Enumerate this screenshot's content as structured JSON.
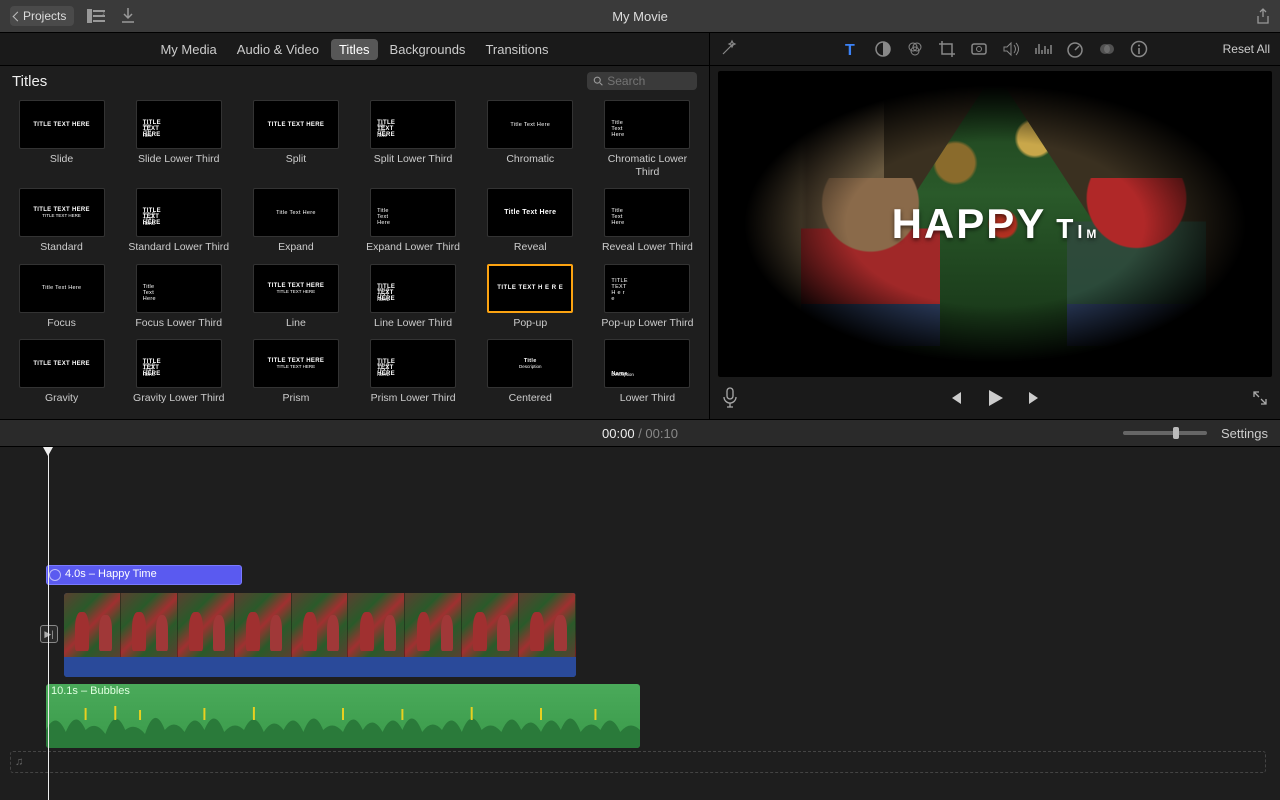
{
  "titlebar": {
    "projects_label": "Projects",
    "movie_title": "My Movie"
  },
  "tabs": {
    "my_media": "My Media",
    "audio_video": "Audio & Video",
    "titles": "Titles",
    "backgrounds": "Backgrounds",
    "transitions": "Transitions",
    "active": "titles"
  },
  "inspector": {
    "reset_all": "Reset All"
  },
  "browser": {
    "heading": "Titles",
    "search_placeholder": "Search",
    "cards": [
      {
        "label": "Slide",
        "thumb_line1": "TITLE TEXT HERE",
        "style": "center-big"
      },
      {
        "label": "Slide Lower Third",
        "thumb_line1": "TITLE TEXT HERE",
        "thumb_line2": "Title Text Here",
        "style": "lower-two"
      },
      {
        "label": "Split",
        "thumb_line1": "TITLE TEXT HERE",
        "style": "center-big"
      },
      {
        "label": "Split Lower Third",
        "thumb_line1": "TITLE TEXT HERE",
        "thumb_line2": "Title Text Here",
        "style": "lower-two"
      },
      {
        "label": "Chromatic",
        "thumb_line1": "Title Text Here",
        "style": "center-small"
      },
      {
        "label": "Chromatic Lower Third",
        "thumb_line1": "Title Text Here",
        "style": "lower-small"
      },
      {
        "label": "Standard",
        "thumb_line1": "TITLE TEXT HERE",
        "thumb_line2": "TITLE TEXT HERE",
        "style": "center-two"
      },
      {
        "label": "Standard Lower Third",
        "thumb_line1": "TITLE TEXT HERE",
        "thumb_line2": "TITLE TEXT HERE",
        "style": "lower-two"
      },
      {
        "label": "Expand",
        "thumb_line1": "Title Text Here",
        "style": "center-small"
      },
      {
        "label": "Expand Lower Third",
        "thumb_line1": "Title Text Here",
        "style": "lower-small"
      },
      {
        "label": "Reveal",
        "thumb_line1": "Title Text Here",
        "style": "center-bold"
      },
      {
        "label": "Reveal Lower Third",
        "thumb_line1": "Title Text Here",
        "style": "lower-small"
      },
      {
        "label": "Focus",
        "thumb_line1": "Title Text Here",
        "style": "center-small"
      },
      {
        "label": "Focus Lower Third",
        "thumb_line1": "Title Text Here",
        "style": "lower-small"
      },
      {
        "label": "Line",
        "thumb_line1": "TITLE TEXT HERE",
        "thumb_line2": "TITLE TEXT HERE",
        "style": "line-two"
      },
      {
        "label": "Line Lower Third",
        "thumb_line1": "TITLE TEXT HERE",
        "thumb_line2": "TITLE TEXT HERE",
        "style": "lower-line"
      },
      {
        "label": "Pop-up",
        "thumb_line1": "TITLE TEXT H E R E",
        "style": "popup",
        "selected": true
      },
      {
        "label": "Pop-up Lower Third",
        "thumb_line1": "TITLE TEXT H e r e",
        "style": "lower-small"
      },
      {
        "label": "Gravity",
        "thumb_line1": "TITLE TEXT HERE",
        "style": "center-big"
      },
      {
        "label": "Gravity Lower Third",
        "thumb_line1": "TITLE TEXT HERE",
        "thumb_line2": "TITLE TEXT HERE",
        "style": "lower-two"
      },
      {
        "label": "Prism",
        "thumb_line1": "TITLE TEXT HERE",
        "thumb_line2": "TITLE TEXT HERE",
        "style": "center-two"
      },
      {
        "label": "Prism Lower Third",
        "thumb_line1": "TITLE TEXT HERE",
        "thumb_line2": "TITLE TEXT HERE",
        "style": "lower-two"
      },
      {
        "label": "Centered",
        "thumb_line1": "Title",
        "thumb_line2": "Description",
        "style": "center-two-sm"
      },
      {
        "label": "Lower Third",
        "thumb_line1": "Name",
        "thumb_line2": "Description",
        "style": "lower-two-sm"
      }
    ]
  },
  "viewer": {
    "overlay_text_parts": [
      "HAPPY",
      "T",
      "I",
      "M"
    ]
  },
  "timeline_head": {
    "current": "00:00",
    "sep": " / ",
    "duration": "00:10",
    "settings": "Settings"
  },
  "timeline": {
    "title_clip_label": "4.0s – Happy Time",
    "audio_clip_label": "10.1s – Bubbles"
  }
}
